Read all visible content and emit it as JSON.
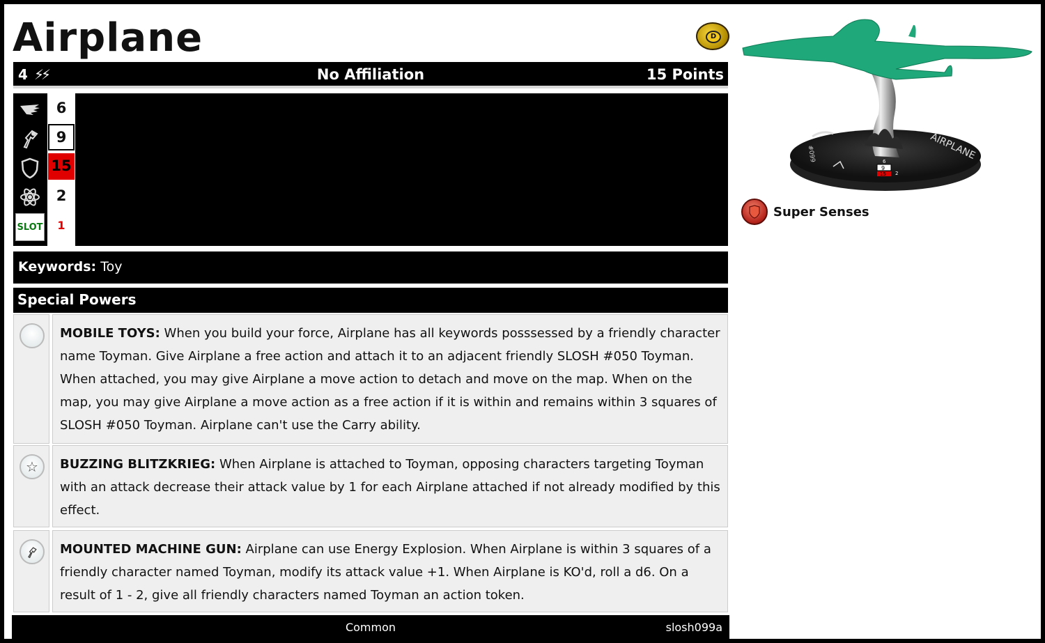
{
  "character": {
    "name": "Airplane",
    "range": "4",
    "attack_bolts": "⚡⚡",
    "affiliation": "No Affiliation",
    "points": "15 Points"
  },
  "dial": {
    "speed": "6",
    "attack": "9",
    "defense": "15",
    "damage": "2",
    "slot_label": "SLOT",
    "slot_value": "1",
    "icons": [
      "wing-speed-icon",
      "blaster-attack-icon",
      "shield-defense-icon",
      "atom-damage-icon"
    ]
  },
  "keywords": {
    "label": "Keywords:",
    "value": "Toy"
  },
  "special_powers_heading": "Special Powers",
  "powers": [
    {
      "icon": "blank-circle-icon",
      "name": "MOBILE TOYS:",
      "text": "When you build your force, Airplane has all keywords posssessed by a friendly character name Toyman. Give Airplane a free action and attach it to an adjacent friendly SLOSH #050 Toyman. When attached, you may give Airplane a move action to detach and move on the map. When on the map, you may give Airplane a move action as a free action if it is within and remains within 3 squares of SLOSH #050 Toyman. Airplane can't use the Carry ability."
    },
    {
      "icon": "star-icon",
      "name": "BUZZING BLITZKRIEG:",
      "text": "When Airplane is attached to Toyman, opposing characters targeting Toyman with an attack decrease their attack value by 1 for each Airplane attached if not already modified by this effect."
    },
    {
      "icon": "blaster-icon",
      "name": "MOUNTED MACHINE GUN:",
      "text": "Airplane can use Energy Explosion. When Airplane is within 3 squares of a friendly character named Toyman, modify its attack value +1. When Airplane is KO'd, roll a d6. On a result of 1 - 2, give all friendly characters named Toyman an action token."
    }
  ],
  "footer": {
    "rarity": "Common",
    "set_id": "slosh099a"
  },
  "figure": {
    "base_name": "AIRPLANE",
    "base_id": "#099",
    "base_dial": [
      "6",
      "9",
      "15",
      "2"
    ]
  },
  "traits": [
    {
      "icon": "super-senses-icon",
      "label": "Super Senses"
    }
  ],
  "colors": {
    "figure_green": "#1fa87a",
    "defense_red": "#e00000",
    "slot_green": "#0a7a12",
    "trait_red": "#b4231b"
  }
}
